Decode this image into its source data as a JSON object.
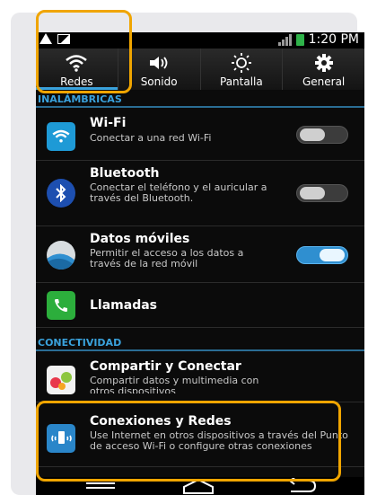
{
  "statusbar": {
    "time": "1:20 PM",
    "icons": [
      "warning-icon",
      "image-icon",
      "signal-icon",
      "battery-icon"
    ]
  },
  "tabs": [
    {
      "label": "Redes",
      "icon": "wifi-icon",
      "active": true
    },
    {
      "label": "Sonido",
      "icon": "speaker-icon"
    },
    {
      "label": "Pantalla",
      "icon": "brightness-icon"
    },
    {
      "label": "General",
      "icon": "gear-icon"
    }
  ],
  "sections": {
    "wireless": "INALÁMBRICAS",
    "connectivity": "CONECTIVIDAD"
  },
  "items": {
    "wifi": {
      "title": "Wi-Fi",
      "subtitle": "Conectar a una red Wi-Fi",
      "toggle": "off"
    },
    "bluetooth": {
      "title": "Bluetooth",
      "subtitle": "Conectar el teléfono y el auricular a través del Bluetooth.",
      "toggle": "off"
    },
    "mobile_data": {
      "title": "Datos móviles",
      "subtitle": "Permitir el acceso a los datos a través de la red móvil",
      "toggle": "on"
    },
    "calls": {
      "title": "Llamadas"
    },
    "share": {
      "title": "Compartir y Conectar",
      "subtitle": "Compartir datos y multimedia con otros dispositivos"
    },
    "connections": {
      "title": "Conexiones y Redes",
      "subtitle": "Use Internet en otros dispositivos a través del Punto de acceso Wi-Fi o configure otras conexiones"
    }
  },
  "colors": {
    "accent": "#3aa2dc",
    "highlight": "#f0a500",
    "toggle_on": "#2f8fd0"
  }
}
